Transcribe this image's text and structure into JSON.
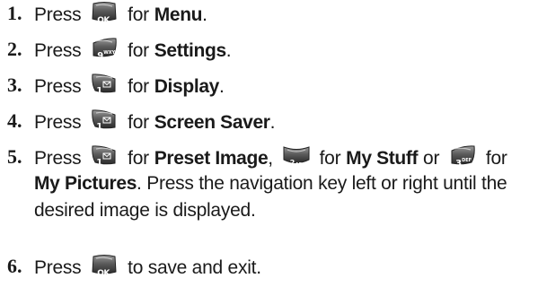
{
  "steps": [
    {
      "number": "1.",
      "press": "Press",
      "for": "for",
      "target": "Menu",
      "end": ".",
      "key": {
        "label": "OK"
      }
    },
    {
      "number": "2.",
      "press": "Press",
      "for": "for",
      "target": "Settings",
      "end": ".",
      "key": {
        "digit": "9",
        "letters": "WXYZ"
      }
    },
    {
      "number": "3.",
      "press": "Press",
      "for": "for",
      "target": "Display",
      "end": ".",
      "key": {
        "digit": "1"
      }
    },
    {
      "number": "4.",
      "press": "Press",
      "for": "for",
      "target": "Screen Saver",
      "end": ".",
      "key": {
        "digit": "1"
      }
    },
    {
      "number": "5.",
      "press": "Press",
      "key1": {
        "digit": "1"
      },
      "for1": "for",
      "target1": "Preset Image",
      "comma": ",",
      "key2": {
        "digit": "2",
        "letters": "ABC"
      },
      "for2": "for",
      "target2": "My Stuff",
      "or": "or",
      "key3": {
        "digit": "3",
        "letters": "DEF"
      },
      "for3": "for",
      "target3": "My Pictures",
      "rest_line2": ". Press the navigation key left or right until the",
      "line3": "desired image is displayed."
    },
    {
      "number": "6.",
      "press": "Press",
      "rest": "to save and exit.",
      "key": {
        "label": "OK"
      }
    }
  ]
}
